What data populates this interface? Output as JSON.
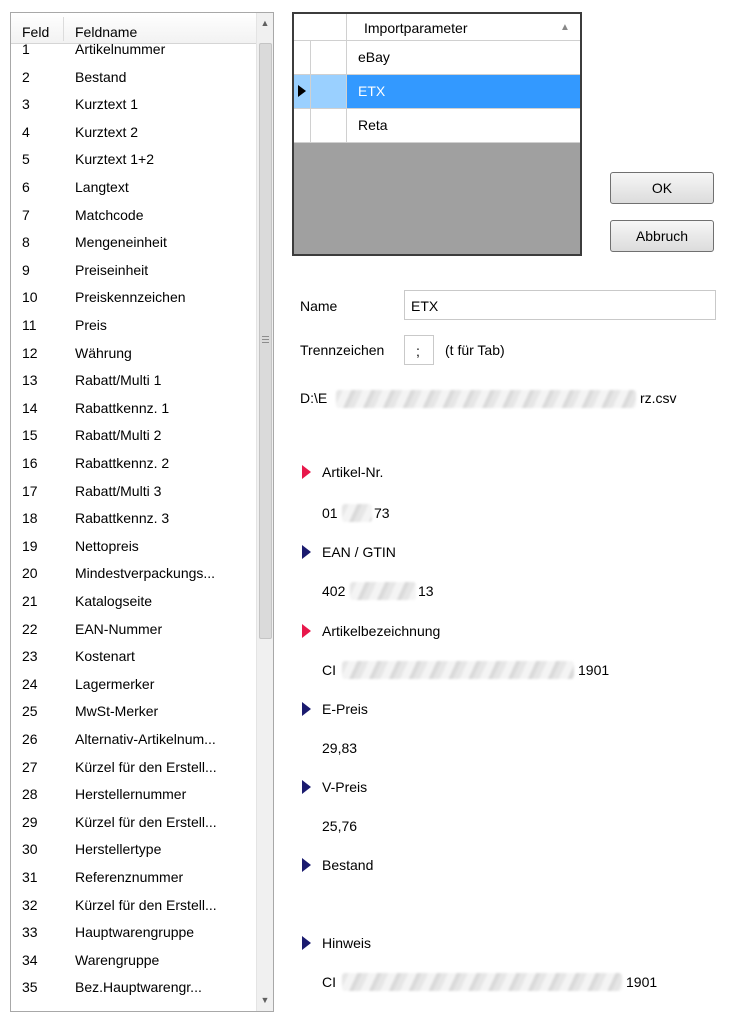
{
  "field_list": {
    "header": {
      "col_num": "Feld",
      "col_name": "Feldname"
    },
    "rows": [
      {
        "num": "1",
        "name": "Artikelnummer"
      },
      {
        "num": "2",
        "name": "Bestand"
      },
      {
        "num": "3",
        "name": "Kurztext 1"
      },
      {
        "num": "4",
        "name": "Kurztext 2"
      },
      {
        "num": "5",
        "name": "Kurztext 1+2"
      },
      {
        "num": "6",
        "name": "Langtext"
      },
      {
        "num": "7",
        "name": "Matchcode"
      },
      {
        "num": "8",
        "name": "Mengeneinheit"
      },
      {
        "num": "9",
        "name": "Preiseinheit"
      },
      {
        "num": "10",
        "name": "Preiskennzeichen"
      },
      {
        "num": "11",
        "name": "Preis"
      },
      {
        "num": "12",
        "name": "Währung"
      },
      {
        "num": "13",
        "name": "Rabatt/Multi 1"
      },
      {
        "num": "14",
        "name": "Rabattkennz. 1"
      },
      {
        "num": "15",
        "name": "Rabatt/Multi 2"
      },
      {
        "num": "16",
        "name": "Rabattkennz. 2"
      },
      {
        "num": "17",
        "name": "Rabatt/Multi 3"
      },
      {
        "num": "18",
        "name": "Rabattkennz. 3"
      },
      {
        "num": "19",
        "name": "Nettopreis"
      },
      {
        "num": "20",
        "name": "Mindestverpackungs..."
      },
      {
        "num": "21",
        "name": "Katalogseite"
      },
      {
        "num": "22",
        "name": "EAN-Nummer"
      },
      {
        "num": "23",
        "name": "Kostenart"
      },
      {
        "num": "24",
        "name": "Lagermerker"
      },
      {
        "num": "25",
        "name": "MwSt-Merker"
      },
      {
        "num": "26",
        "name": "Alternativ-Artikelnum..."
      },
      {
        "num": "27",
        "name": "Kürzel für den Erstell..."
      },
      {
        "num": "28",
        "name": "Herstellernummer"
      },
      {
        "num": "29",
        "name": "Kürzel für den Erstell..."
      },
      {
        "num": "30",
        "name": "Herstellertype"
      },
      {
        "num": "31",
        "name": "Referenznummer"
      },
      {
        "num": "32",
        "name": "Kürzel für den Erstell..."
      },
      {
        "num": "33",
        "name": "Hauptwarengruppe"
      },
      {
        "num": "34",
        "name": "Warengruppe"
      },
      {
        "num": "35",
        "name": "Bez.Hauptwarengr..."
      }
    ]
  },
  "import_params": {
    "header": "Importparameter",
    "rows": [
      "eBay",
      "ETX",
      "Reta"
    ],
    "selected": "ETX"
  },
  "buttons": {
    "ok": "OK",
    "cancel": "Abbruch"
  },
  "form": {
    "name_label": "Name",
    "name_value": "ETX",
    "sep_label": "Trennzeichen",
    "sep_value": ";",
    "sep_hint": "(t für Tab)",
    "file_prefix": "D:\\E",
    "file_suffix": "rz.csv"
  },
  "preview": {
    "artikel_label": "Artikel-Nr.",
    "artikel_value_a": "01",
    "artikel_value_b": "73",
    "ean_label": "EAN / GTIN",
    "ean_value_a": "402",
    "ean_value_b": "13",
    "bez_label": "Artikelbezeichnung",
    "bez_value_a": "CI",
    "bez_value_b": "1901",
    "epreis_label": "E-Preis",
    "epreis_value": "29,83",
    "vpreis_label": "V-Preis",
    "vpreis_value": "25,76",
    "bestand_label": "Bestand",
    "hinweis_label": "Hinweis",
    "hinweis_value_a": "CI",
    "hinweis_value_b": "1901"
  },
  "colors": {
    "required_marker": "#e8184b",
    "optional_marker": "#1b1b6f",
    "selection": "#3399ff"
  },
  "icons": [
    "scroll-up-icon",
    "scroll-down-icon",
    "sort-ascending-icon",
    "row-pointer-icon",
    "triangle-marker-icon"
  ]
}
